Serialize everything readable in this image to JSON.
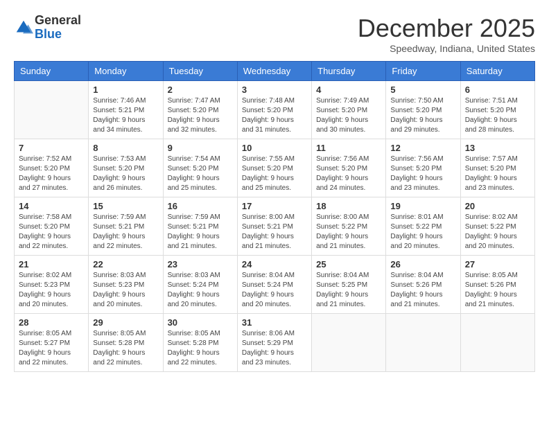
{
  "logo": {
    "general": "General",
    "blue": "Blue",
    "arrow_color": "#1a6bbf"
  },
  "header": {
    "month_year": "December 2025",
    "location": "Speedway, Indiana, United States"
  },
  "weekdays": [
    "Sunday",
    "Monday",
    "Tuesday",
    "Wednesday",
    "Thursday",
    "Friday",
    "Saturday"
  ],
  "weeks": [
    [
      {
        "day": "",
        "empty": true
      },
      {
        "day": "1",
        "sunrise": "Sunrise: 7:46 AM",
        "sunset": "Sunset: 5:21 PM",
        "daylight": "Daylight: 9 hours and 34 minutes."
      },
      {
        "day": "2",
        "sunrise": "Sunrise: 7:47 AM",
        "sunset": "Sunset: 5:20 PM",
        "daylight": "Daylight: 9 hours and 32 minutes."
      },
      {
        "day": "3",
        "sunrise": "Sunrise: 7:48 AM",
        "sunset": "Sunset: 5:20 PM",
        "daylight": "Daylight: 9 hours and 31 minutes."
      },
      {
        "day": "4",
        "sunrise": "Sunrise: 7:49 AM",
        "sunset": "Sunset: 5:20 PM",
        "daylight": "Daylight: 9 hours and 30 minutes."
      },
      {
        "day": "5",
        "sunrise": "Sunrise: 7:50 AM",
        "sunset": "Sunset: 5:20 PM",
        "daylight": "Daylight: 9 hours and 29 minutes."
      },
      {
        "day": "6",
        "sunrise": "Sunrise: 7:51 AM",
        "sunset": "Sunset: 5:20 PM",
        "daylight": "Daylight: 9 hours and 28 minutes."
      }
    ],
    [
      {
        "day": "7",
        "sunrise": "Sunrise: 7:52 AM",
        "sunset": "Sunset: 5:20 PM",
        "daylight": "Daylight: 9 hours and 27 minutes."
      },
      {
        "day": "8",
        "sunrise": "Sunrise: 7:53 AM",
        "sunset": "Sunset: 5:20 PM",
        "daylight": "Daylight: 9 hours and 26 minutes."
      },
      {
        "day": "9",
        "sunrise": "Sunrise: 7:54 AM",
        "sunset": "Sunset: 5:20 PM",
        "daylight": "Daylight: 9 hours and 25 minutes."
      },
      {
        "day": "10",
        "sunrise": "Sunrise: 7:55 AM",
        "sunset": "Sunset: 5:20 PM",
        "daylight": "Daylight: 9 hours and 25 minutes."
      },
      {
        "day": "11",
        "sunrise": "Sunrise: 7:56 AM",
        "sunset": "Sunset: 5:20 PM",
        "daylight": "Daylight: 9 hours and 24 minutes."
      },
      {
        "day": "12",
        "sunrise": "Sunrise: 7:56 AM",
        "sunset": "Sunset: 5:20 PM",
        "daylight": "Daylight: 9 hours and 23 minutes."
      },
      {
        "day": "13",
        "sunrise": "Sunrise: 7:57 AM",
        "sunset": "Sunset: 5:20 PM",
        "daylight": "Daylight: 9 hours and 23 minutes."
      }
    ],
    [
      {
        "day": "14",
        "sunrise": "Sunrise: 7:58 AM",
        "sunset": "Sunset: 5:20 PM",
        "daylight": "Daylight: 9 hours and 22 minutes."
      },
      {
        "day": "15",
        "sunrise": "Sunrise: 7:59 AM",
        "sunset": "Sunset: 5:21 PM",
        "daylight": "Daylight: 9 hours and 22 minutes."
      },
      {
        "day": "16",
        "sunrise": "Sunrise: 7:59 AM",
        "sunset": "Sunset: 5:21 PM",
        "daylight": "Daylight: 9 hours and 21 minutes."
      },
      {
        "day": "17",
        "sunrise": "Sunrise: 8:00 AM",
        "sunset": "Sunset: 5:21 PM",
        "daylight": "Daylight: 9 hours and 21 minutes."
      },
      {
        "day": "18",
        "sunrise": "Sunrise: 8:00 AM",
        "sunset": "Sunset: 5:22 PM",
        "daylight": "Daylight: 9 hours and 21 minutes."
      },
      {
        "day": "19",
        "sunrise": "Sunrise: 8:01 AM",
        "sunset": "Sunset: 5:22 PM",
        "daylight": "Daylight: 9 hours and 20 minutes."
      },
      {
        "day": "20",
        "sunrise": "Sunrise: 8:02 AM",
        "sunset": "Sunset: 5:22 PM",
        "daylight": "Daylight: 9 hours and 20 minutes."
      }
    ],
    [
      {
        "day": "21",
        "sunrise": "Sunrise: 8:02 AM",
        "sunset": "Sunset: 5:23 PM",
        "daylight": "Daylight: 9 hours and 20 minutes."
      },
      {
        "day": "22",
        "sunrise": "Sunrise: 8:03 AM",
        "sunset": "Sunset: 5:23 PM",
        "daylight": "Daylight: 9 hours and 20 minutes."
      },
      {
        "day": "23",
        "sunrise": "Sunrise: 8:03 AM",
        "sunset": "Sunset: 5:24 PM",
        "daylight": "Daylight: 9 hours and 20 minutes."
      },
      {
        "day": "24",
        "sunrise": "Sunrise: 8:04 AM",
        "sunset": "Sunset: 5:24 PM",
        "daylight": "Daylight: 9 hours and 20 minutes."
      },
      {
        "day": "25",
        "sunrise": "Sunrise: 8:04 AM",
        "sunset": "Sunset: 5:25 PM",
        "daylight": "Daylight: 9 hours and 21 minutes."
      },
      {
        "day": "26",
        "sunrise": "Sunrise: 8:04 AM",
        "sunset": "Sunset: 5:26 PM",
        "daylight": "Daylight: 9 hours and 21 minutes."
      },
      {
        "day": "27",
        "sunrise": "Sunrise: 8:05 AM",
        "sunset": "Sunset: 5:26 PM",
        "daylight": "Daylight: 9 hours and 21 minutes."
      }
    ],
    [
      {
        "day": "28",
        "sunrise": "Sunrise: 8:05 AM",
        "sunset": "Sunset: 5:27 PM",
        "daylight": "Daylight: 9 hours and 22 minutes."
      },
      {
        "day": "29",
        "sunrise": "Sunrise: 8:05 AM",
        "sunset": "Sunset: 5:28 PM",
        "daylight": "Daylight: 9 hours and 22 minutes."
      },
      {
        "day": "30",
        "sunrise": "Sunrise: 8:05 AM",
        "sunset": "Sunset: 5:28 PM",
        "daylight": "Daylight: 9 hours and 22 minutes."
      },
      {
        "day": "31",
        "sunrise": "Sunrise: 8:06 AM",
        "sunset": "Sunset: 5:29 PM",
        "daylight": "Daylight: 9 hours and 23 minutes."
      },
      {
        "day": "",
        "empty": true
      },
      {
        "day": "",
        "empty": true
      },
      {
        "day": "",
        "empty": true
      }
    ]
  ]
}
